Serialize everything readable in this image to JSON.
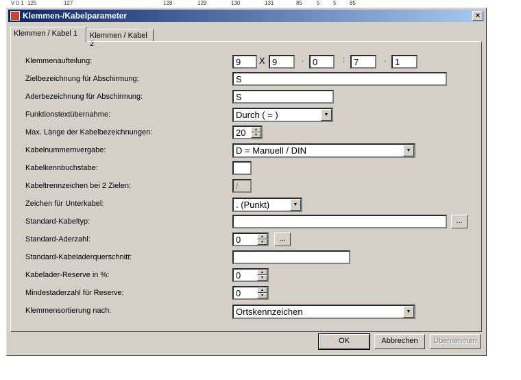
{
  "ruler": {
    "marks": [
      "V 0 1",
      "125",
      "127",
      "128",
      "129",
      "130",
      "131",
      "85",
      "5",
      "5",
      "85"
    ]
  },
  "window": {
    "title": "Klemmen-/Kabelparameter",
    "close_symbol": "×"
  },
  "tabs": [
    {
      "label": "Klemmen / Kabel 1"
    },
    {
      "label": "Klemmen / Kabel 2"
    }
  ],
  "fields": {
    "klemmenaufteilung": {
      "label": "Klemmenaufteilung:",
      "v1": "9",
      "sep1": "X",
      "v2": "9",
      "sep2": ".",
      "v3": "0",
      "sep3": ":",
      "v4": "7",
      "sep4": ".",
      "v5": "1"
    },
    "zielbezeichnung": {
      "label": "Zielbezeichnung für Abschirmung:",
      "value": "S"
    },
    "aderbezeichnung": {
      "label": "Aderbezeichnung für Abschirmung:",
      "value": "S"
    },
    "funktionstext": {
      "label": "Funktionstextübernahme:",
      "value": "Durch ( = )"
    },
    "max_laenge": {
      "label": "Max. Länge der Kabelbezeichnungen:",
      "value": "20"
    },
    "kabelnummernvergabe": {
      "label": "Kabelnummernvergabe:",
      "value": "D = Manuell / DIN"
    },
    "kabelkennbuchstabe": {
      "label": "Kabelkennbuchstabe:",
      "value": ""
    },
    "kabeltrennzeichen": {
      "label": "Kabeltrennzeichen bei 2 Zielen:",
      "value": "/"
    },
    "unterkabel": {
      "label": "Zeichen für Unterkabel:",
      "value": ". (Punkt)"
    },
    "kabeltyp": {
      "label": "Standard-Kabeltyp:",
      "value": "",
      "button": "..."
    },
    "aderzahl": {
      "label": "Standard-Aderzahl:",
      "value": "0",
      "button": "..."
    },
    "querschnitt": {
      "label": "Standard-Kabeladerquerschnitt:",
      "value": ""
    },
    "reserve": {
      "label": "Kabelader-Reserve in %:",
      "value": "0"
    },
    "mindestaderzahl": {
      "label": "Mindestaderzahl für Reserve:",
      "value": "0"
    },
    "sortierung": {
      "label": "Klemmensortierung nach:",
      "value": "Ortskennzeichen"
    }
  },
  "buttons": {
    "ok": "OK",
    "abbrechen": "Abbrechen",
    "uebernehmen": "Übernehmen"
  },
  "icons": {
    "combo_arrow": "▼",
    "spin_up": "▲",
    "spin_down": "▼"
  }
}
